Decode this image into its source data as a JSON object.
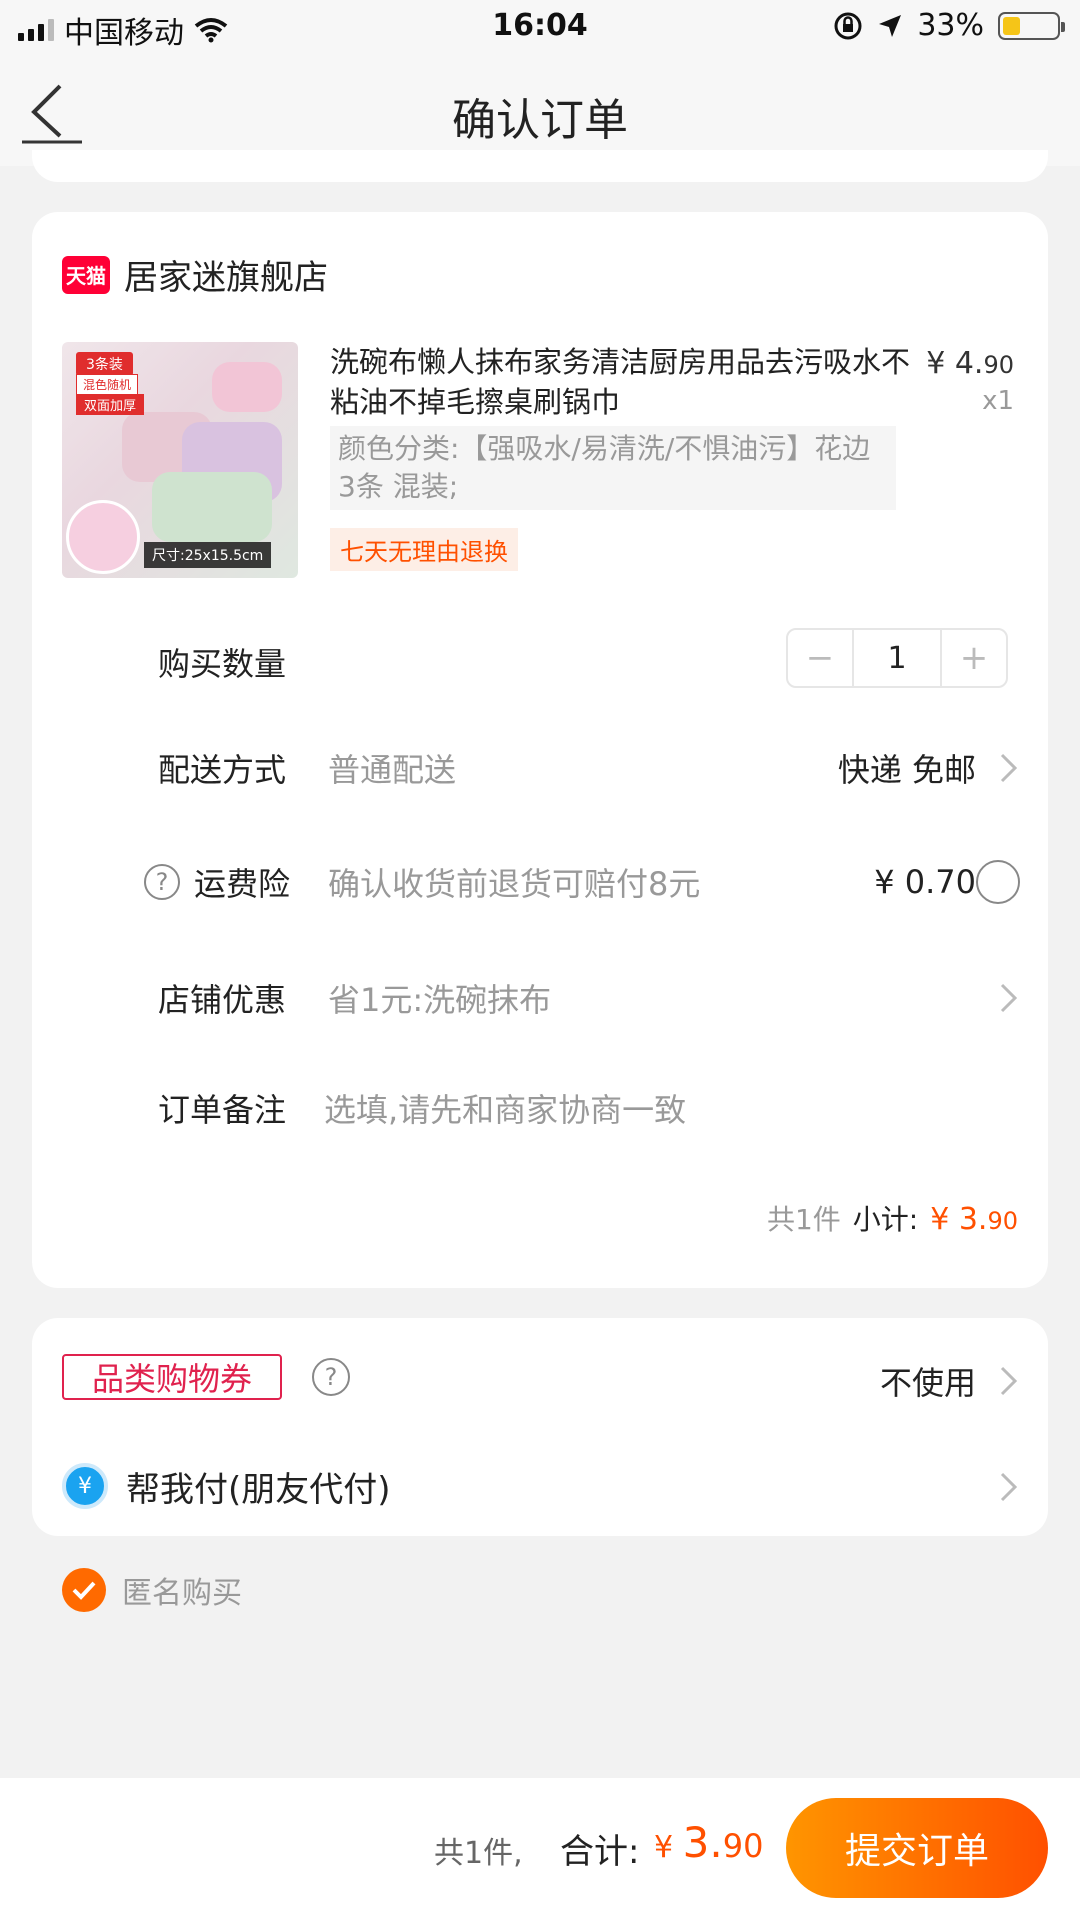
{
  "status_bar": {
    "carrier": "中国移动",
    "time": "16:04",
    "battery": "33%",
    "icons": [
      "signal-icon",
      "wifi-icon",
      "rotation-lock-icon",
      "location-icon",
      "battery-icon"
    ]
  },
  "nav": {
    "title": "确认订单",
    "back_icon": "back-arrow-icon"
  },
  "shop": {
    "badge": "天猫",
    "name": "居家迷旗舰店"
  },
  "product": {
    "title": "洗碗布懒人抹布家务清洁厨房用品去污吸水不粘油不掉毛擦桌刷锅巾",
    "price_main": "¥ 4.",
    "price_decimal": "90",
    "quantity": "x1",
    "spec": "颜色分类:【强吸水/易清洗/不惧油污】花边3条 混装;",
    "return_policy": "七天无理由退换",
    "image_text": {
      "tag1": "3条装",
      "tag2": "混色随机",
      "tag3": "双面加厚",
      "size": "尺寸:25x15.5cm"
    }
  },
  "rows": {
    "quantity": {
      "label": "购买数量",
      "value": "1",
      "minus": "−",
      "plus": "+"
    },
    "delivery": {
      "label": "配送方式",
      "desc": "普通配送",
      "value": "快递 免邮"
    },
    "insurance": {
      "label": "运费险",
      "desc": "确认收货前退货可赔付8元",
      "value": "¥ 0.70",
      "help": "?"
    },
    "discount": {
      "label": "店铺优惠",
      "desc": "省1元:洗碗抹布"
    },
    "note": {
      "label": "订单备注",
      "placeholder": "选填,请先和商家协商一致"
    }
  },
  "subtotal": {
    "count": "共1件",
    "label": "小计:",
    "amount_main": "¥ 3.",
    "amount_decimal": "90"
  },
  "extras": {
    "coupon_tag": "品类购物券",
    "coupon_help": "?",
    "coupon_value": "不使用",
    "pay_icon": "¥",
    "pay_label": "帮我付(朋友代付)"
  },
  "anonymous": {
    "label": "匿名购买",
    "checked": true
  },
  "bottom": {
    "count": "共1件,",
    "total_label": "合计:",
    "currency": "¥ ",
    "total_int": "3.",
    "total_decimal": "90",
    "submit": "提交订单"
  },
  "colors": {
    "accent": "#ff5000",
    "tmall_red": "#ff0036",
    "coupon_red": "#e0224e",
    "pay_blue": "#1aa3f0"
  }
}
